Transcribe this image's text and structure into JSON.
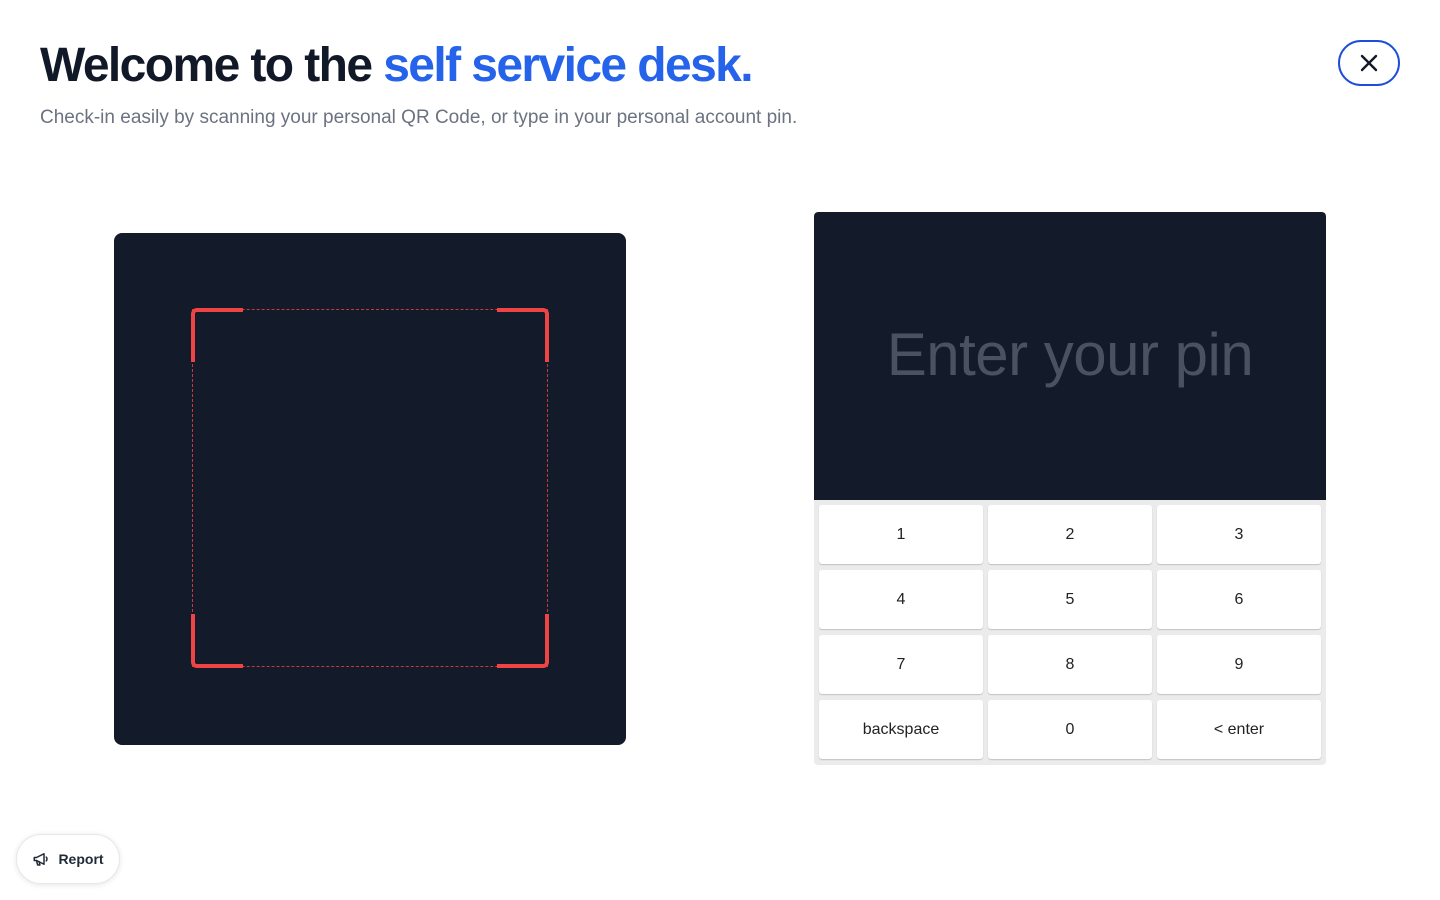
{
  "header": {
    "title_prefix": "Welcome to the",
    "title_accent": "self service desk.",
    "subtitle": "Check-in easily by scanning your personal QR Code, or type in your personal account pin."
  },
  "close_button": {
    "icon": "close-icon"
  },
  "scanner": {
    "icon": "qr-scan-frame"
  },
  "pinpad": {
    "placeholder": "Enter your pin",
    "keys": [
      "1",
      "2",
      "3",
      "4",
      "5",
      "6",
      "7",
      "8",
      "9",
      "backspace",
      "0",
      "< enter"
    ]
  },
  "report": {
    "label": "Report",
    "icon": "megaphone-icon"
  },
  "colors": {
    "accent": "#2563eb",
    "dark_panel": "#131a29",
    "scan_frame": "#ef4444",
    "text_primary": "#111827",
    "text_muted": "#6b7280"
  }
}
